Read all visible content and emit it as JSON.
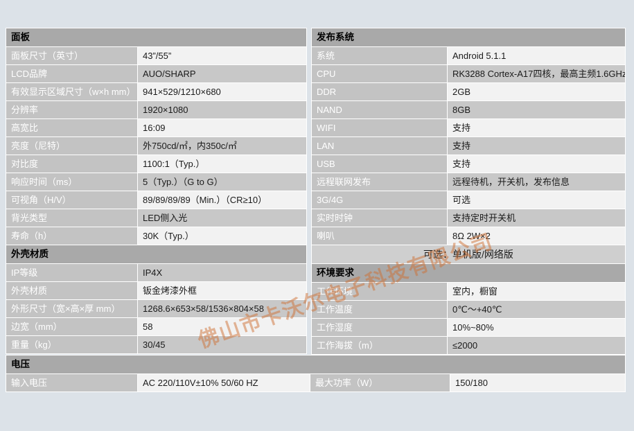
{
  "colors": {
    "page_background": "#dce2e8",
    "section_header_bg": "#a9a9a9",
    "label_bg": "#c3c3c3",
    "label_text": "#ffffff",
    "value_bg_light": "#f2f2f2",
    "value_bg_dark": "#c8c8c8",
    "watermark": "#ce7034"
  },
  "watermark": {
    "text": "佛山市卡沃尔电子科技有限公司"
  },
  "left_table": {
    "sections": [
      {
        "title": "面板",
        "rows": [
          {
            "label": "面板尺寸（英寸）",
            "value": "43”/55”"
          },
          {
            "label": "LCD品牌",
            "value": "AUO/SHARP"
          },
          {
            "label": "有效显示区域尺寸（w×h mm）",
            "value": "941×529/1210×680"
          },
          {
            "label": "分辨率",
            "value": "1920×1080"
          },
          {
            "label": "高宽比",
            "value": "16:09"
          },
          {
            "label": "亮度（尼特）",
            "value": "外750cd/㎡，内350c/㎡"
          },
          {
            "label": "对比度",
            "value": "1100:1（Typ.）"
          },
          {
            "label": "响应时间（ms）",
            "value": "5（Typ.）（G to G）"
          },
          {
            "label": "可视角（H/V）",
            "value": "89/89/89/89（Min.）（CR≥10）"
          },
          {
            "label": "背光类型",
            "value": "LED侧入光"
          },
          {
            "label": "寿命（h）",
            "value": "30K（Typ.）"
          }
        ]
      },
      {
        "title": "外壳材质",
        "rows": [
          {
            "label": "IP等级",
            "value": "IP4X"
          },
          {
            "label": "外壳材质",
            "value": "钣金烤漆外框"
          },
          {
            "label": "外形尺寸（宽×高×厚 mm）",
            "value": "1268.6×653×58/1536×804×58"
          },
          {
            "label": "边宽（mm）",
            "value": "58"
          },
          {
            "label": "重量（kg）",
            "value": "30/45"
          }
        ]
      }
    ]
  },
  "right_table": {
    "sections": [
      {
        "title": "发布系统",
        "rows": [
          {
            "label": "系统",
            "value": "Android 5.1.1"
          },
          {
            "label": "CPU",
            "value": "RK3288 Cortex-A17四核，最高主频1.6GHz"
          },
          {
            "label": "DDR",
            "value": "2GB"
          },
          {
            "label": "NAND",
            "value": "8GB"
          },
          {
            "label": "WIFI",
            "value": "支持"
          },
          {
            "label": "LAN",
            "value": "支持"
          },
          {
            "label": "USB",
            "value": "支持"
          },
          {
            "label": "远程联网发布",
            "value": "远程待机，开关机，发布信息"
          },
          {
            "label": "3G/4G",
            "value": "可选"
          },
          {
            "label": "实时时钟",
            "value": "支持定时开关机"
          },
          {
            "label": "喇叭",
            "value": "8Ω 2W×2"
          }
        ],
        "note": "可选：单机版/网络版"
      },
      {
        "title": "环境要求",
        "rows": [
          {
            "label": "工作环境",
            "value": "室内，橱窗"
          },
          {
            "label": "工作温度",
            "value": "0℃～+40℃"
          },
          {
            "label": "工作湿度",
            "value": "10%~80%"
          },
          {
            "label": "工作海拔（m）",
            "value": "≤2000"
          }
        ]
      }
    ]
  },
  "voltage_section": {
    "title": "电压",
    "row": {
      "label_left": "输入电压",
      "value_left": "AC 220/110V±10%  50/60 HZ",
      "label_right": "最大功率（W）",
      "value_right": "150/180"
    }
  }
}
